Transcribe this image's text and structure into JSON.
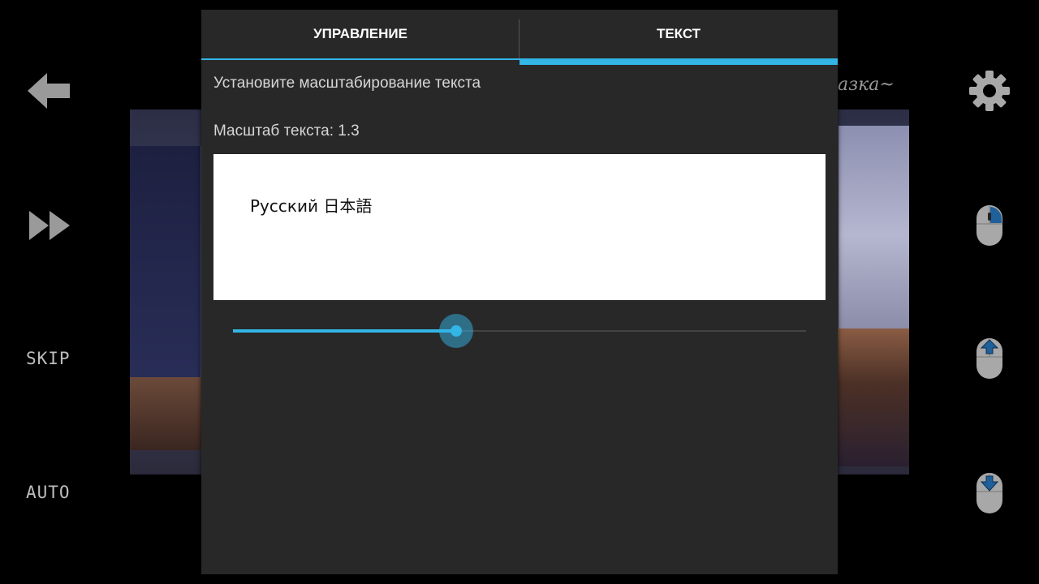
{
  "background": {
    "caption": "азка~"
  },
  "side_left": {
    "back_icon": "arrow-left-icon",
    "fast_forward_icon": "fast-forward-icon",
    "skip_label": "SKIP",
    "auto_label": "AUTO"
  },
  "side_right": {
    "settings_icon": "gear-icon",
    "mouse_icons": [
      "mouse-right-click-icon",
      "mouse-scroll-up-icon",
      "mouse-scroll-down-icon"
    ]
  },
  "dialog": {
    "tabs": [
      {
        "label": "УПРАВЛЕНИЕ",
        "active": false
      },
      {
        "label": "ТЕКСТ",
        "active": true
      }
    ],
    "description": "Установите масштабирование текста",
    "scale_label": "Масштаб текста: 1.3",
    "preview_text": "Русский 日本語",
    "slider": {
      "value_fraction": 0.39
    },
    "accent_color": "#33b5e5"
  }
}
